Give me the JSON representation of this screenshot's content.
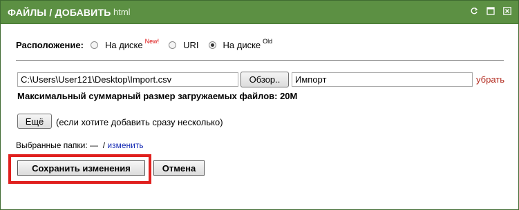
{
  "window": {
    "title": "ФАЙЛЫ / ДОБАВИТЬ",
    "subtitle": "html",
    "title_bar_color": "#5c9043",
    "controls": [
      {
        "icon": "refresh-icon"
      },
      {
        "icon": "maximize-icon"
      },
      {
        "icon": "close-icon"
      }
    ]
  },
  "location": {
    "label": "Расположение:",
    "options": [
      {
        "label": "На диске",
        "badge": "New!",
        "checked": false
      },
      {
        "label": "URI",
        "badge": "",
        "checked": false
      },
      {
        "label": "На диске",
        "badge": "Old",
        "checked": true
      }
    ]
  },
  "file_row": {
    "path_value": "C:\\Users\\User121\\Desktop\\Import.csv",
    "browse_label": "Обзор..",
    "name_value": "Импорт",
    "remove_label": "убрать"
  },
  "max_size_text": "Максимальный суммарный размер загружаемых файлов: 20M",
  "more": {
    "button_label": "Ещё",
    "hint": "(если хотите добавить сразу несколько)"
  },
  "folders": {
    "label": "Выбранные папки:",
    "value": "—",
    "separator": "/",
    "change_link": "изменить"
  },
  "actions": {
    "save_label": "Сохранить изменения",
    "cancel_label": "Отмена",
    "highlight_color": "#e0201e"
  }
}
